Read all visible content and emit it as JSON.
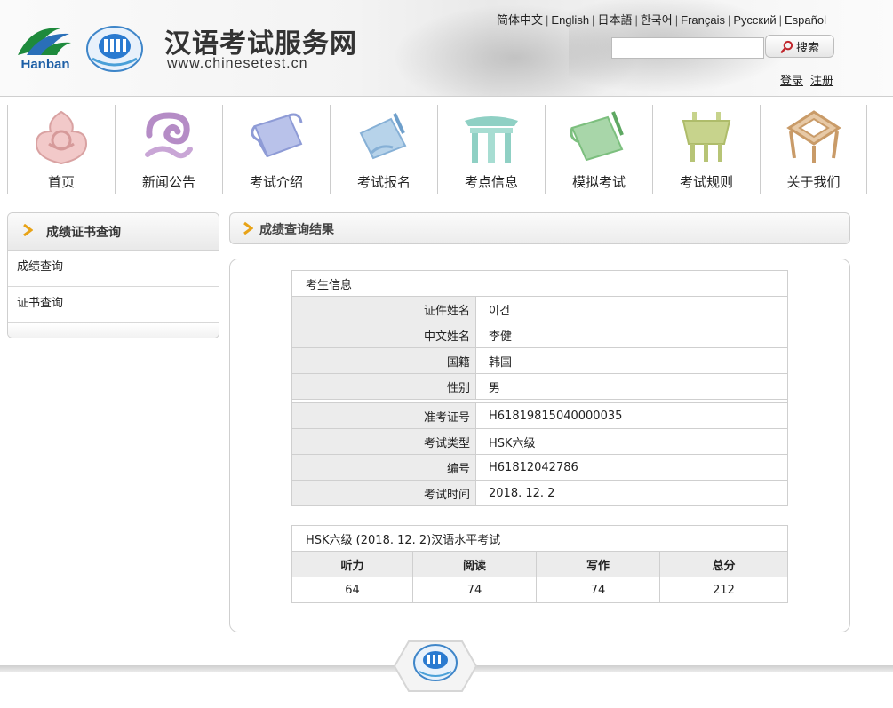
{
  "header": {
    "logo_text": "Hanban",
    "title": "汉语考试服务网",
    "url": "www.chinesetest.cn",
    "languages": [
      "简体中文",
      "English",
      "日本語",
      "한국어",
      "Français",
      "Русский",
      "Español"
    ],
    "search_placeholder": "",
    "search_label": "搜索",
    "login": "登录",
    "register": "注册"
  },
  "nav": {
    "items": [
      "首页",
      "新闻公告",
      "考试介绍",
      "考试报名",
      "考点信息",
      "模拟考试",
      "考试规则",
      "关于我们"
    ]
  },
  "sidebar": {
    "title": "成绩证书查询",
    "items": [
      "成绩查询",
      "证书查询"
    ]
  },
  "main": {
    "title": "成绩查询结果",
    "info_caption": "考生信息",
    "personal": [
      {
        "label": "证件姓名",
        "value": "이건"
      },
      {
        "label": "中文姓名",
        "value": "李健"
      },
      {
        "label": "国籍",
        "value": "韩国"
      },
      {
        "label": "性别",
        "value": "男"
      }
    ],
    "exam": [
      {
        "label": "准考证号",
        "value": "H61819815040000035"
      },
      {
        "label": "考试类型",
        "value": "HSK六级"
      },
      {
        "label": "编号",
        "value": "H61812042786"
      },
      {
        "label": "考试时间",
        "value": "2018. 12. 2"
      }
    ],
    "score_caption": "HSK六级 (2018. 12. 2)汉语水平考试",
    "score_headers": [
      "听力",
      "阅读",
      "写作",
      "总分"
    ],
    "score_values": [
      "64",
      "74",
      "74",
      "212"
    ]
  },
  "colors": {
    "accent_arrow": "#e8a317",
    "border": "#cfcfcf",
    "label_bg": "#ececec"
  }
}
